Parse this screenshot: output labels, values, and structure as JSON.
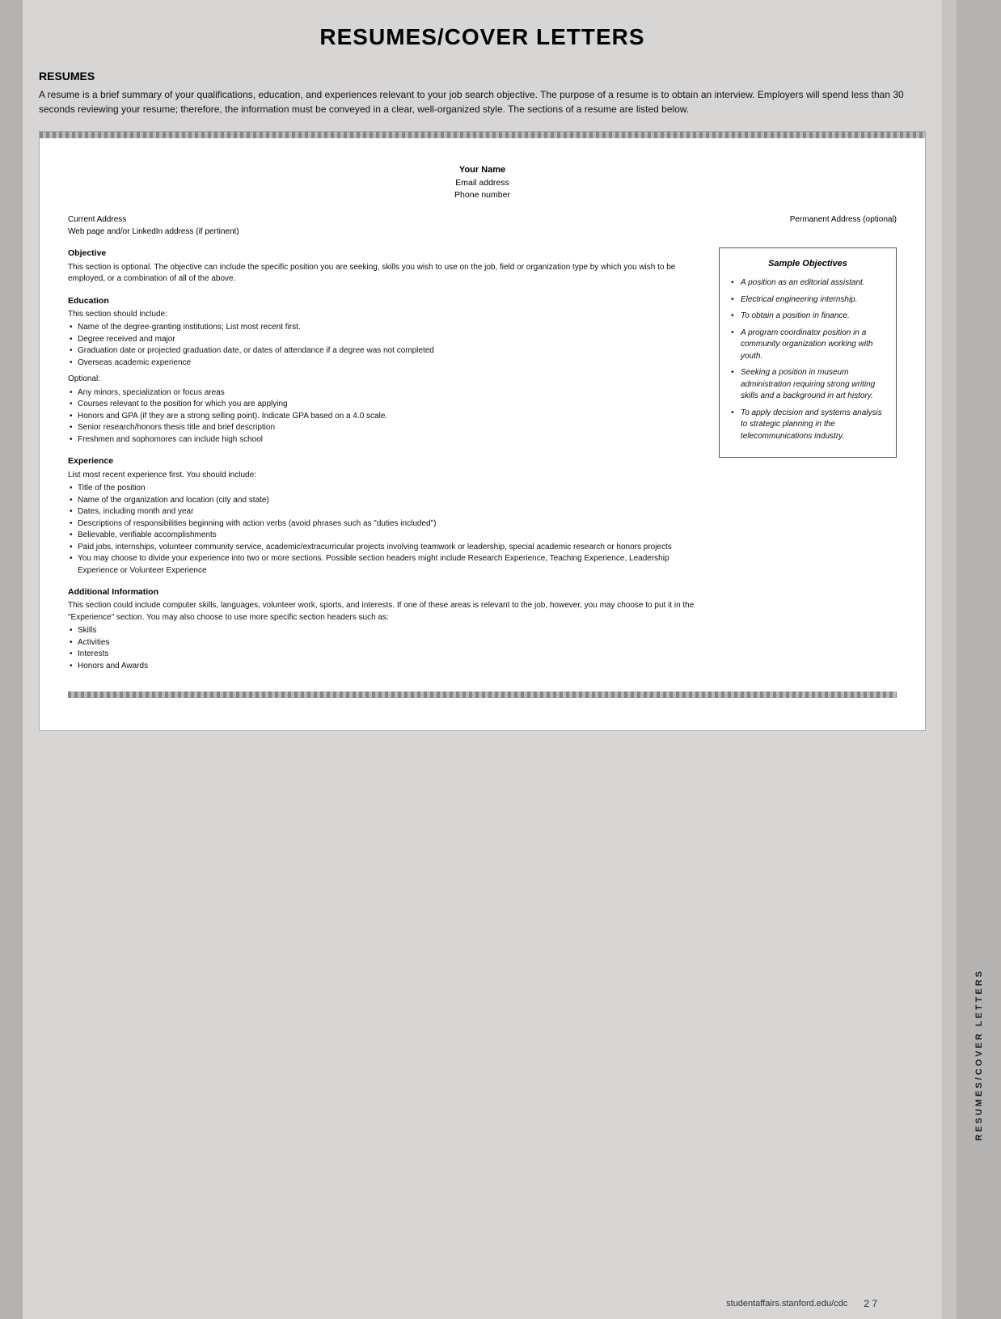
{
  "page": {
    "title": "RESUMES/COVER LETTERS",
    "section_heading": "RESUMES",
    "intro": "A resume is a brief summary of your qualifications, education, and experiences relevant to your job search objective. The purpose of a resume is to obtain an interview. Employers will spend less than 30 seconds reviewing your resume; therefore, the information must be conveyed in a clear, well-organized style. The sections of a resume are listed below."
  },
  "resume": {
    "name": "Your Name",
    "email": "Email address",
    "phone": "Phone number",
    "current_address": "Current Address",
    "web": "Web page and/or LinkedIn address (if pertinent)",
    "permanent_address": "Permanent Address (optional)",
    "objective_title": "Objective",
    "objective_text": "This section is optional. The objective can include the specific position you are seeking, skills you wish to use on the job, field or organization type by which you wish to be employed, or a combination of all of the above.",
    "education_title": "Education",
    "education_intro": "This section should include:",
    "education_items": [
      "Name of the degree-granting institutions; List most recent first.",
      "Degree received and major",
      "Graduation date or projected graduation date, or dates of attendance if a degree was not completed",
      "Overseas academic experience"
    ],
    "education_optional_label": "Optional:",
    "education_optional_items": [
      "Any minors, specialization or focus areas",
      "Courses relevant to the position for which you are applying",
      "Honors and GPA (if they are a strong selling point). Indicate GPA based on a 4.0 scale.",
      "Senior research/honors thesis title and brief description",
      "Freshmen and sophomores can include high school"
    ],
    "experience_title": "Experience",
    "experience_intro": "List most recent experience first. You should include:",
    "experience_items": [
      "Title of the position",
      "Name of the organization and location (city and state)",
      "Dates, including month and year",
      "Descriptions of responsibilities beginning with action verbs (avoid phrases such as \"duties included\")",
      "Believable, verifiable accomplishments",
      "Paid jobs, internships, volunteer community service, academic/extracurricular projects involving teamwork or leadership, special academic research or honors projects",
      "You may choose to divide your experience into two or more sections. Possible section headers might include Research Experience, Teaching Experience, Leadership Experience or Volunteer Experience"
    ],
    "additional_title": "Additional Information",
    "additional_text": "This section could include computer skills, languages, volunteer work, sports, and interests. If one of these areas is relevant to the job, however, you may choose to put it in the \"Experience\" section. You may also choose to use more specific section headers such as:",
    "additional_items": [
      "Skills",
      "Activities",
      "Interests",
      "Honors and Awards"
    ]
  },
  "sample_objectives": {
    "title": "Sample Objectives",
    "items": [
      "A position as an editorial assistant.",
      "Electrical engineering internship.",
      "To obtain a position in finance.",
      "A program coordinator position in a community organization working with youth.",
      "Seeking a position in museum administration requiring strong writing skills and a background in art history.",
      "To apply decision and systems analysis to strategic planning in the telecommunications industry."
    ]
  },
  "footer": {
    "url": "studentaffairs.stanford.edu/cdc",
    "page": "2 7"
  },
  "sidebar_label": "RESUMES/COVER LETTERS"
}
